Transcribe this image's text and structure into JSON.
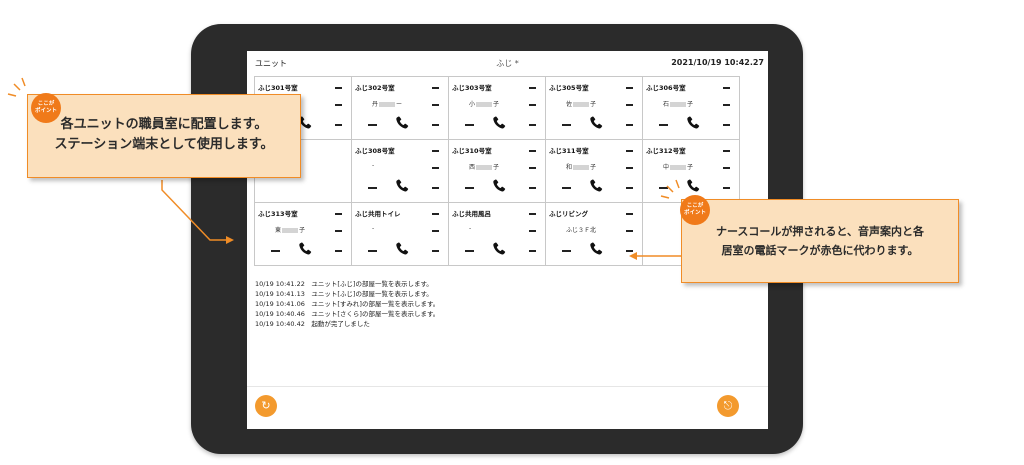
{
  "topbar": {
    "unit_label": "ユニット",
    "unit_name": "ふじ *",
    "datetime": "2021/10/19 10:42.27"
  },
  "rooms": [
    [
      {
        "name": "ふじ301号室",
        "resident_a": "",
        "resident_b": ""
      },
      {
        "name": "ふじ302号室",
        "resident_a": "丹",
        "resident_b": "ー"
      },
      {
        "name": "ふじ303号室",
        "resident_a": "小",
        "resident_b": "子"
      },
      {
        "name": "ふじ305号室",
        "resident_a": "佐",
        "resident_b": "子"
      },
      {
        "name": "ふじ306号室",
        "resident_a": "石",
        "resident_b": "子"
      }
    ],
    [
      {
        "name": "",
        "resident_a": "",
        "resident_b": ""
      },
      {
        "name": "ふじ308号室",
        "resident_a": "-",
        "resident_b": ""
      },
      {
        "name": "ふじ310号室",
        "resident_a": "西",
        "resident_b": "子"
      },
      {
        "name": "ふじ311号室",
        "resident_a": "和",
        "resident_b": "子"
      },
      {
        "name": "ふじ312号室",
        "resident_a": "中",
        "resident_b": "子"
      }
    ],
    [
      {
        "name": "ふじ313号室",
        "resident_a": "東",
        "resident_b": "子"
      },
      {
        "name": "ふじ共用トイレ",
        "resident_a": "-",
        "resident_b": ""
      },
      {
        "name": "ふじ共用風呂",
        "resident_a": "-",
        "resident_b": ""
      },
      {
        "name": "ふじリビング",
        "resident_a": "ふじ３Ｆ北",
        "resident_b": ""
      },
      {
        "name": "",
        "resident_a": "",
        "resident_b": ""
      }
    ]
  ],
  "log": [
    "10/19 10:41.22　ユニット[ふじ]の部屋一覧を表示します。",
    "10/19 10:41.13　ユニット[ふじ]の部屋一覧を表示します。",
    "10/19 10:41.06　ユニット[すみれ]の部屋一覧を表示します。",
    "10/19 10:40.46　ユニット[さくら]の部屋一覧を表示します。",
    "10/19 10:40.42　起動が完了しました"
  ],
  "callouts": {
    "left": {
      "badge": "ここが\nポイント",
      "line1": "各ユニットの職員室に配置します。",
      "line2": "ステーション端末として使用します。"
    },
    "right": {
      "badge": "ここが\nポイント",
      "line1": "ナースコールが押されると、音声案内と各",
      "line2": "居室の電話マークが赤色に代わります。"
    }
  },
  "buttons": {
    "refresh_icon": "refresh-icon",
    "logout_icon": "logout-icon"
  },
  "colors": {
    "accent": "#f39a2e",
    "callout_fill": "#fbe0bd",
    "callout_border": "#f08c26",
    "tablet": "#2b2b2b"
  }
}
